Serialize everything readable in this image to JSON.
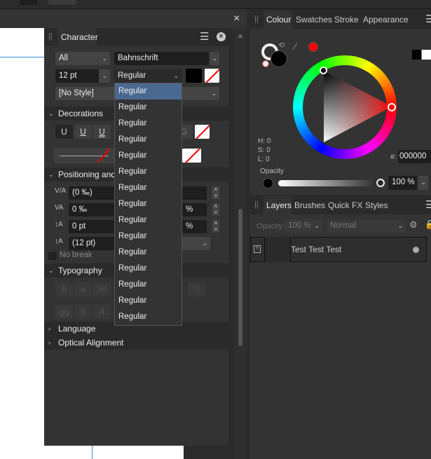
{
  "toolbar": {
    "close": "×"
  },
  "character": {
    "tab": "Character",
    "scope": "All",
    "font_family": "Bahnschrift",
    "font_size": "12 pt",
    "font_style": "Regular",
    "paragraph_style": "[No Style]",
    "style_options": [
      "Regular",
      "Regular",
      "Regular",
      "Regular",
      "Regular",
      "Regular",
      "Regular",
      "Regular",
      "Regular",
      "Regular",
      "Regular",
      "Regular",
      "Regular",
      "Regular",
      "Regular"
    ],
    "sections": {
      "decorations": "Decorations",
      "positioning": "Positioning and",
      "typography": "Typography",
      "language": "Language",
      "optical": "Optical Alignment"
    },
    "decoration_buttons": [
      "U",
      "U",
      "U"
    ],
    "kerning": "(0 ‰)",
    "tracking": "0 ‰",
    "baseline": "0 pt",
    "leading": "(12 pt)",
    "percent1": "%",
    "percent2": "%",
    "no_break": "No break",
    "typography_buttons": [
      "fi",
      "a",
      "1st",
      "Tт",
      "gg",
      "fi",
      "A"
    ]
  },
  "colour": {
    "tabs": [
      "Colour",
      "Swatches",
      "Stroke",
      "Appearance"
    ],
    "h": "H: 0",
    "s": "S: 0",
    "l": "L: 0",
    "hex_label": "#:",
    "hex": "000000",
    "opacity_label": "Opacity",
    "opacity": "100 %",
    "picked_color": "#ff0000",
    "fill_color": "#000000"
  },
  "layers": {
    "tabs": [
      "Layers",
      "Brushes",
      "Quick FX",
      "Styles"
    ],
    "opacity_label": "Opacity:",
    "opacity": "100 %",
    "blend": "Normal",
    "items": [
      {
        "name": "Test Test Test"
      }
    ]
  }
}
